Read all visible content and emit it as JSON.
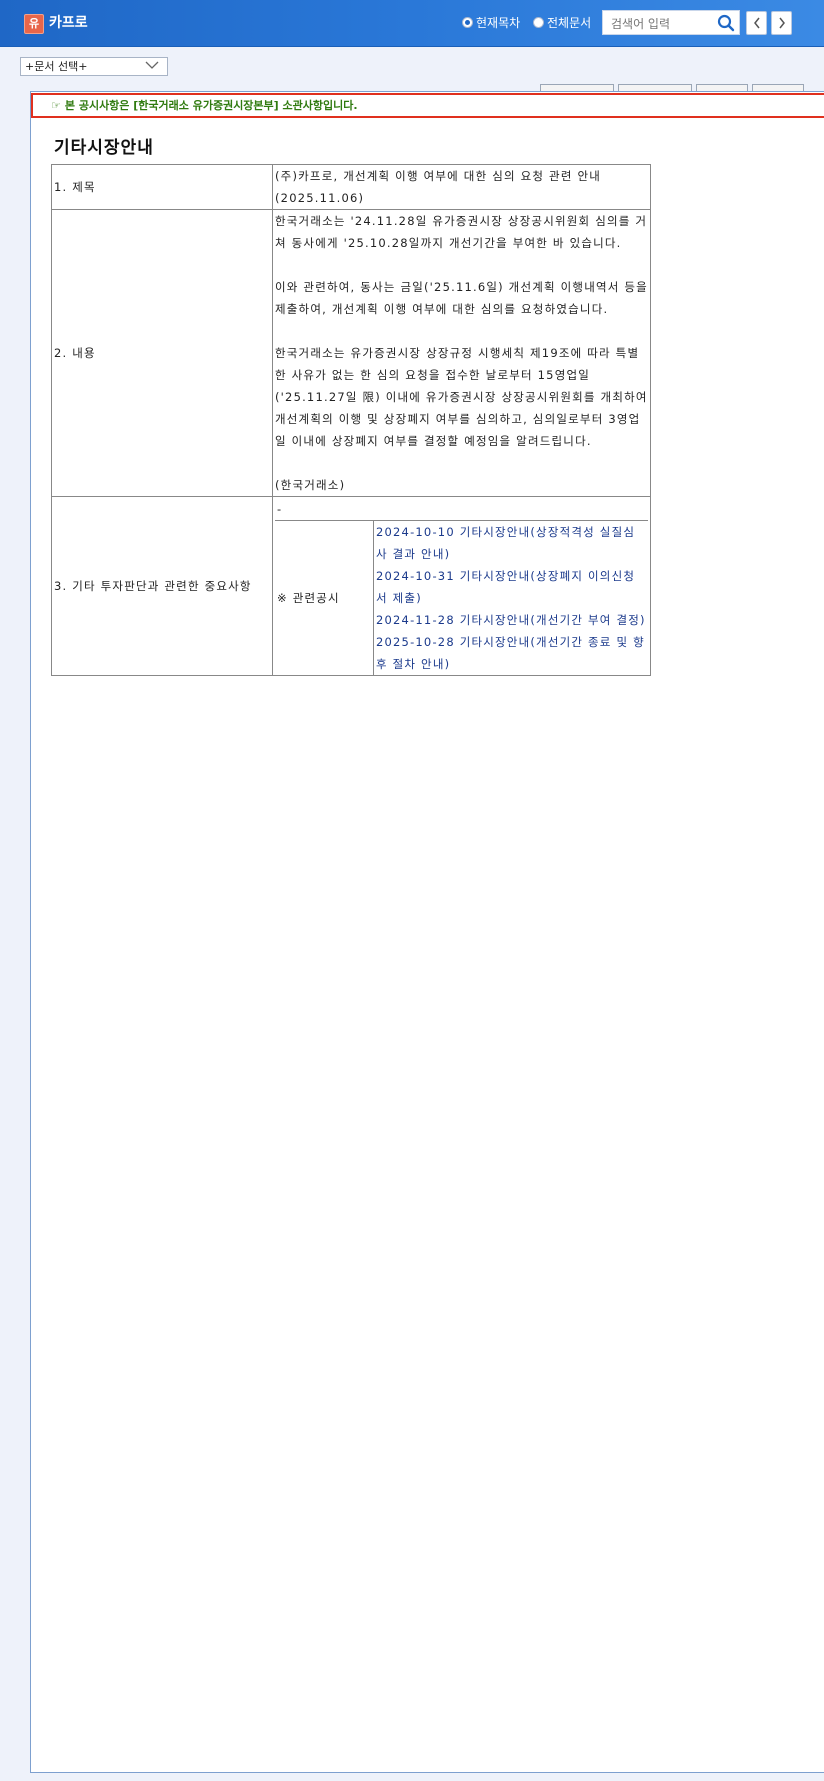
{
  "header": {
    "logo_badge": "유",
    "company": "카프로",
    "radio_current": "현재목차",
    "radio_all": "전체문서",
    "search_placeholder": "검색어 입력"
  },
  "doc_select": {
    "value": "+문서 선택+"
  },
  "notice": {
    "text": "본 공시사항은 [한국거래소 유가증권시장본부] 소관사항입니다."
  },
  "document": {
    "title": "기타시장안내",
    "rows": {
      "title": {
        "label": "1. 제목",
        "value": "(주)카프로, 개선계획 이행 여부에 대한 심의 요청 관련 안내(2025.11.06)"
      },
      "content": {
        "label": "2. 내용",
        "paragraphs": [
          "한국거래소는 '24.11.28일 유가증권시장 상장공시위원회 심의를 거쳐 동사에게 '25.10.28일까지 개선기간을 부여한 바 있습니다.",
          "이와 관련하여, 동사는 금일('25.11.6일) 개선계획 이행내역서 등을 제출하여, 개선계획 이행 여부에 대한 심의를 요청하였습니다.",
          "한국거래소는 유가증권시장 상장규정 시행세칙 제19조에 따라 특별한 사유가 없는 한 심의 요청을 접수한 날로부터 15영업일('25.11.27일 限) 이내에 유가증권시장 상장공시위원회를 개최하여 개선계획의 이행 및 상장폐지 여부를 심의하고, 심의일로부터 3영업일 이내에 상장폐지 여부를 결정할 예정임을 알려드립니다.",
          "(한국거래소)"
        ]
      },
      "other": {
        "label": "3. 기타 투자판단과 관련한 중요사항",
        "value": "-",
        "related_label": "※ 관련공시",
        "related_links": [
          "2024-10-10 기타시장안내(상장적격성 실질심사 결과 안내)",
          "2024-10-31 기타시장안내(상장폐지 이의신청서 제출)",
          "2024-11-28 기타시장안내(개선기간 부여 결정)",
          "2025-10-28 기타시장안내(개선기간 종료 및 향후 절차 안내)"
        ]
      }
    }
  }
}
